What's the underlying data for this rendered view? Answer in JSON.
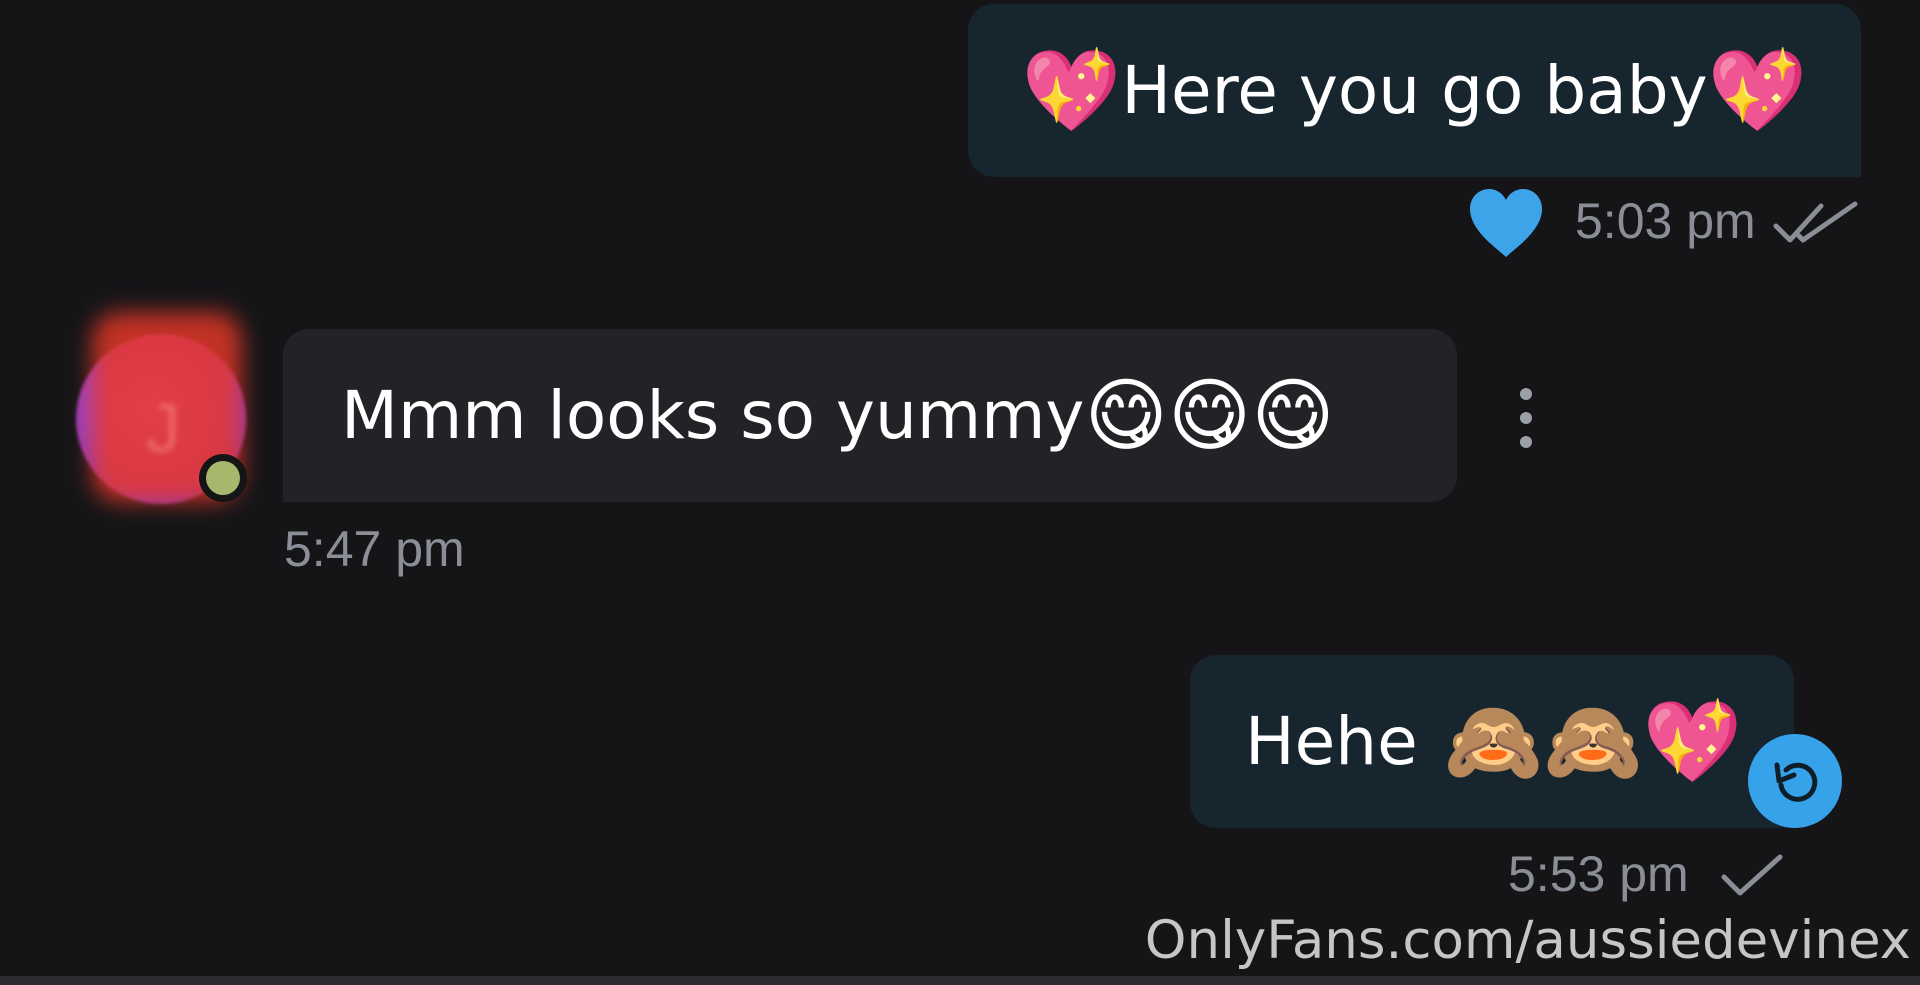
{
  "colors": {
    "background": "#151518",
    "outgoing_bubble": "#17252f",
    "incoming_bubble": "#232327",
    "accent_blue": "#36a2e9",
    "timestamp_gray": "#8a8f97"
  },
  "messages": [
    {
      "direction": "outgoing",
      "emoji_before": "💖",
      "text": "Here you go baby",
      "emoji_after": "💖",
      "reaction_icon": "blue-heart-icon",
      "time": "5:03 pm",
      "status_icon": "double-check-icon"
    },
    {
      "direction": "incoming",
      "avatar_letter": "J",
      "avatar_icon": "avatar",
      "online_indicator": true,
      "text": "Mmm looks so yummy",
      "emojis": [
        "😋",
        "😋",
        "😋"
      ],
      "menu_icon": "more-vertical-icon",
      "time": "5:47 pm"
    },
    {
      "direction": "outgoing",
      "text": "Hehe",
      "emojis": [
        "🙈",
        "🙈",
        "💖"
      ],
      "action_icon": "undo-icon",
      "time": "5:53 pm",
      "status_icon": "check-icon"
    }
  ],
  "watermark": "OnlyFans.com/aussiedevinex"
}
